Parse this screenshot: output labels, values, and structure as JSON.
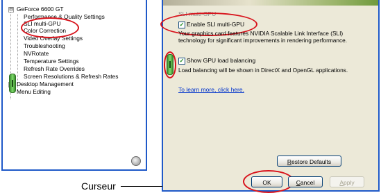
{
  "tree": {
    "items": [
      {
        "label": "GeForce 6600 GT",
        "expander": "⊟"
      },
      {
        "label": "Performance & Quality Settings"
      },
      {
        "label": "SLI multi-GPU"
      },
      {
        "label": "Color Correction"
      },
      {
        "label": "Video Overlay Settings"
      },
      {
        "label": "Troubleshooting"
      },
      {
        "label": "NVRotate"
      },
      {
        "label": "Temperature Settings"
      },
      {
        "label": "Refresh Rate Overrides"
      },
      {
        "label": "Screen Resolutions & Refresh Rates"
      },
      {
        "label": "Desktop Management",
        "expander": "⊞"
      },
      {
        "label": "Menu Editing"
      }
    ],
    "selected_item": "SLI multi-GPU"
  },
  "settings": {
    "group_title": "SLI multi-GPU",
    "enable_sli": {
      "label": "Enable SLI multi-GPU",
      "checked": true
    },
    "sli_description": "Your graphics card features NVIDIA Scalable Link Interface (SLI) technology for significant improvements in rendering performance.",
    "gpu_balancing": {
      "label": "Show GPU load balancing",
      "checked": true
    },
    "balancing_description": "Load balancing will be shown in DirectX and OpenGL applications.",
    "learn_more_link": "To learn more, click here.",
    "restore_defaults_label": "Restore Defaults"
  },
  "dialog_buttons": {
    "ok_label": "OK",
    "cancel_label": "Cancel",
    "apply_label": "Apply"
  },
  "callout": {
    "label": "Curseur"
  },
  "icons": {
    "tree_handle": "slider-handle-icon",
    "settings_handle": "slider-handle-icon",
    "hand": "hand-cursor-icon",
    "checkmark": "checkmark-icon"
  },
  "colors": {
    "window_border": "#1f59c8",
    "highlight_oval": "#d8121b",
    "handle_green": "#7fdc6b",
    "panel_background": "#ece9d8",
    "link": "#0033cc"
  }
}
